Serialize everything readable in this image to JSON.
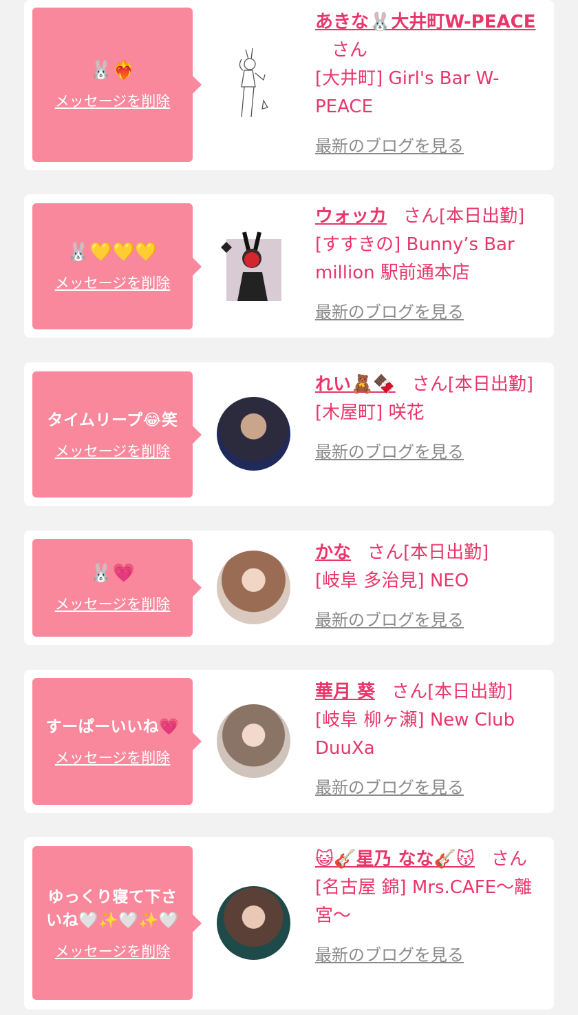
{
  "colors": {
    "page_bg": "#f2f2f2",
    "card_bg": "#ffffff",
    "bubble_bg": "#f9889c",
    "accent": "#e8366a",
    "link_gray": "#8a8a8a"
  },
  "delete_label": "メッセージを削除",
  "blog_label": "最新のブログを見る",
  "cards": [
    {
      "message": "🐰❤️‍🔥",
      "name": "あきな🐰大井町W-PEACE",
      "suffix": "さん",
      "shop": "[大井町] Girl's Bar W-PEACE",
      "avatar_icon": "bunny-girl-sketch-icon"
    },
    {
      "message": "🐰💛💛💛",
      "name": "ウォッカ",
      "suffix": "さん[本日出勤]",
      "shop": "[すすきの] Bunny’s Bar million 駅前通本店",
      "avatar_icon": "bunny-girl-photo-icon"
    },
    {
      "message": "タイムリープ😂笑",
      "name": "れい🧸🍫",
      "suffix": "さん[本日出勤]",
      "shop": "[木屋町] 咲花",
      "avatar_icon": "profile-photo-icon"
    },
    {
      "message": "🐰💗",
      "name": "かな",
      "suffix": "さん[本日出勤]",
      "shop": "[岐阜 多治見] NEO",
      "avatar_icon": "profile-photo-icon"
    },
    {
      "message": "すーぱーいいね💗",
      "name": "華月 葵",
      "suffix": "さん[本日出勤]",
      "shop": "[岐阜 柳ヶ瀬] New Club DuuXa",
      "avatar_icon": "profile-photo-icon"
    },
    {
      "message": "ゆっくり寝て下さいね🤍✨🤍✨🤍",
      "name": "😺🎸星乃 なな🎸😽",
      "suffix": "さん",
      "shop": "[名古屋 錦] Mrs.CAFE〜離宮〜",
      "avatar_icon": "profile-photo-icon"
    }
  ]
}
